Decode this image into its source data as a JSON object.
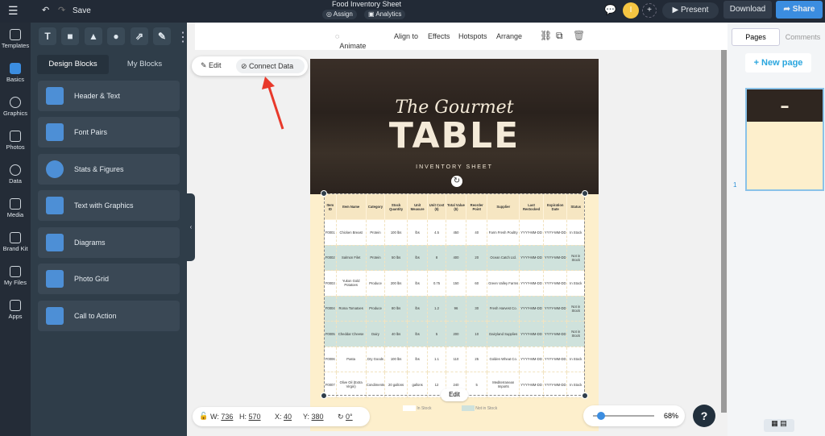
{
  "topbar": {
    "title": "Food Inventory Sheet",
    "save": "Save",
    "assign": "Assign",
    "analytics": "Analytics",
    "avatar": "I",
    "present": "Present",
    "download": "Download",
    "share": "Share"
  },
  "rail": [
    {
      "label": "Templates"
    },
    {
      "label": "Basics"
    },
    {
      "label": "Graphics"
    },
    {
      "label": "Photos"
    },
    {
      "label": "Data"
    },
    {
      "label": "Media"
    },
    {
      "label": "Brand Kit"
    },
    {
      "label": "My Files"
    },
    {
      "label": "Apps"
    }
  ],
  "panel": {
    "tools": [
      "T",
      "■",
      "▲",
      "●",
      "⇗",
      "✎"
    ],
    "tabs": [
      "Design Blocks",
      "My Blocks"
    ],
    "blocks": [
      "Header & Text",
      "Font Pairs",
      "Stats & Figures",
      "Text with Graphics",
      "Diagrams",
      "Photo Grid",
      "Call to Action"
    ]
  },
  "toolbar": {
    "animate": "Animate",
    "align": "Align to",
    "effects": "Effects",
    "hotspots": "Hotspots",
    "arrange": "Arrange"
  },
  "pill": {
    "edit": "Edit",
    "connect": "Connect Data"
  },
  "doc": {
    "title_script": "The Gourmet",
    "title_main": "TABLE",
    "subtitle": "INVENTORY SHEET",
    "headers": [
      "Item ID",
      "Item Name",
      "Category",
      "Stock Quantity",
      "Unit Measure",
      "Unit Cost ($)",
      "Total Value ($)",
      "Reorder Point",
      "Supplier",
      "Last Restocked",
      "Expiration Date",
      "Status"
    ],
    "rows": [
      [
        "F0001",
        "Chicken Breast",
        "Protein",
        "100 lbs",
        "lbs",
        "4.5",
        "450",
        "40",
        "Farm Fresh Poultry",
        "YYYY-MM-DD",
        "YYYY-MM-DD",
        "In Stock"
      ],
      [
        "F0002",
        "Salmon Filet",
        "Protein",
        "50 lbs",
        "lbs",
        "8",
        "400",
        "20",
        "Ocean Catch Ltd.",
        "YYYY-MM-DD",
        "YYYY-MM-DD",
        "Not in Stock"
      ],
      [
        "F0003",
        "Yukon Gold Potatoes",
        "Produce",
        "200 lbs",
        "lbs",
        "0.75",
        "150",
        "60",
        "Green Valley Farms",
        "YYYY-MM-DD",
        "YYYY-MM-DD",
        "In Stock"
      ],
      [
        "F0004",
        "Roma Tomatoes",
        "Produce",
        "80 lbs",
        "lbs",
        "1.2",
        "96",
        "30",
        "Fresh Harvest Co.",
        "YYYY-MM-DD",
        "YYYY-MM-DD",
        "Not in Stock"
      ],
      [
        "F0005",
        "Cheddar Cheese",
        "Dairy",
        "40 lbs",
        "lbs",
        "5",
        "200",
        "10",
        "Dairyland Supplies",
        "YYYY-MM-DD",
        "YYYY-MM-DD",
        "Not in Stock"
      ],
      [
        "F0006",
        "Pasta",
        "Dry Goods",
        "100 lbs",
        "lbs",
        "1.1",
        "110",
        "25",
        "Golden Wheat Co.",
        "YYYY-MM-DD",
        "YYYY-MM-DD",
        "In Stock"
      ],
      [
        "F0007",
        "Olive Oil (Extra Virgin)",
        "Condiments",
        "20 gallons",
        "gallons",
        "12",
        "240",
        "5",
        "Mediterranean Imports",
        "YYYY-MM-DD",
        "YYYY-MM-DD",
        "In Stock"
      ]
    ],
    "legend_in": "In Stock",
    "legend_out": "Not in Stock",
    "edit": "Edit"
  },
  "colors": {
    "in_stock": "#ffffff",
    "not_in_stock": "#cfe2dc",
    "accent": "#3b8de0"
  },
  "geometry_readout": {
    "w_label": "W:",
    "w": "736",
    "h_label": "H:",
    "h": "570",
    "x_label": "X:",
    "x": "40",
    "y_label": "Y:",
    "y": "380",
    "rotation": "0°"
  },
  "zoom": {
    "percent": "68%",
    "value": 68
  },
  "help": "?",
  "right": {
    "tabs": [
      "Pages",
      "Comments"
    ],
    "new_page": "+ New page",
    "page_number": "1"
  }
}
